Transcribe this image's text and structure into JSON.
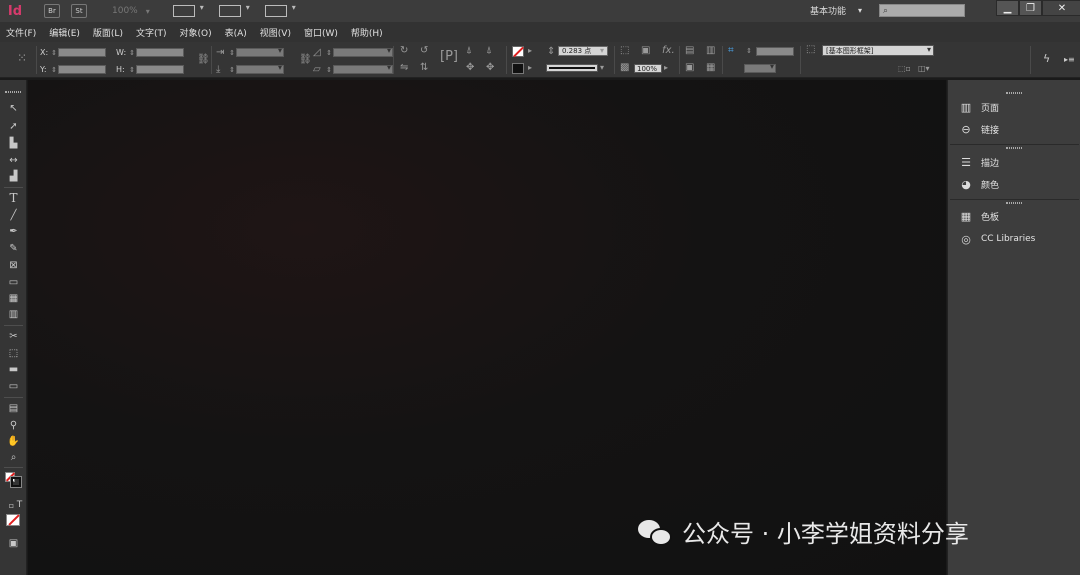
{
  "appbar": {
    "logo": "Id",
    "bridge": "Br",
    "stock": "St",
    "zoom": "100%",
    "workspace": "基本功能",
    "search_placeholder": ""
  },
  "window": {
    "minimize": "▁",
    "restore": "❐",
    "close": "✕"
  },
  "menu": [
    "文件(F)",
    "编辑(E)",
    "版面(L)",
    "文字(T)",
    "对象(O)",
    "表(A)",
    "视图(V)",
    "窗口(W)",
    "帮助(H)"
  ],
  "control": {
    "x_label": "X:",
    "y_label": "Y:",
    "w_label": "W:",
    "h_label": "H:",
    "stroke_weight": "0.283 点",
    "opacity": "100%",
    "object_style": "[基本图形框架]"
  },
  "panels": {
    "pages": "页面",
    "links": "链接",
    "stroke": "描边",
    "color": "颜色",
    "swatches": "色板",
    "cc_libraries": "CC Libraries"
  },
  "watermark": "公众号 · 小李学姐资料分享",
  "colors": {
    "accent": "#d63b6c",
    "background": "#111111",
    "panel": "#3d3d3d"
  }
}
